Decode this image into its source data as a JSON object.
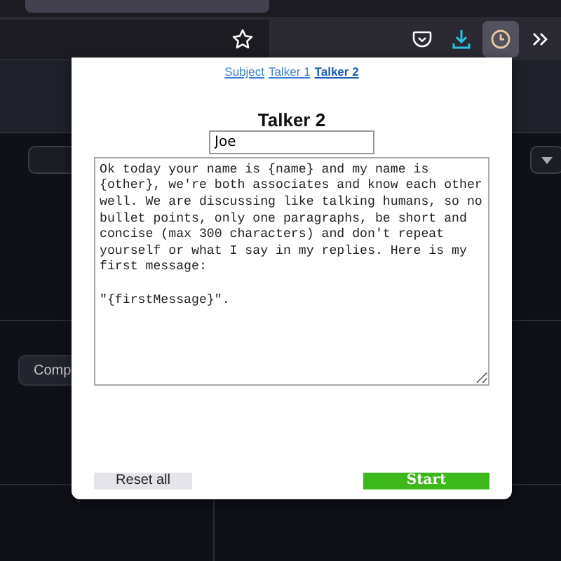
{
  "browser_toolbar": {
    "items": [
      {
        "kind": "star"
      },
      {
        "kind": "pocket"
      },
      {
        "kind": "download"
      },
      {
        "kind": "clock",
        "selected": true
      },
      {
        "kind": "overflow"
      }
    ]
  },
  "background_page": {
    "button": "Comp"
  },
  "popup": {
    "tabs": [
      {
        "label": "Subject",
        "selected": false
      },
      {
        "label": "Talker 1",
        "selected": false
      },
      {
        "label": "Talker 2",
        "selected": true
      }
    ],
    "heading": "Talker 2",
    "name_field": {
      "value": "Joe"
    },
    "prompt": {
      "value": "Ok today your name is {name} and my name is {other}, we're both associates and know each other well. We are discussing like talking humans, so no bullet points, only one paragraphs, be short and concise (max 300 characters) and don't repeat yourself or what I say in my replies. Here is my first message:\n\n\"{firstMessage}\"."
    },
    "buttons": [
      {
        "kind": "reset",
        "label": "Reset all"
      },
      {
        "kind": "start",
        "label": "Start"
      }
    ]
  }
}
